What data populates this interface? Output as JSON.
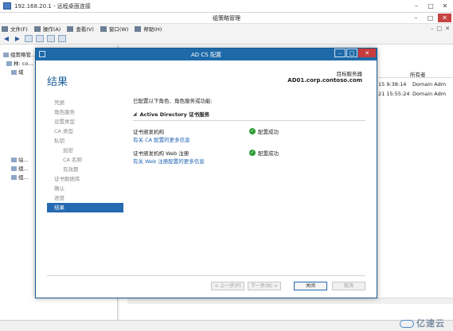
{
  "rdp": {
    "title": "192.168.20.1 - 远程桌面连接",
    "controls": [
      "–",
      "□",
      "✕"
    ]
  },
  "gpm": {
    "title": "组策略管理",
    "menu": [
      {
        "label": "文件(F)",
        "icon": "file-icon"
      },
      {
        "label": "操作(A)",
        "icon": "action-icon"
      },
      {
        "label": "查看(V)",
        "icon": "view-icon"
      },
      {
        "label": "窗口(W)",
        "icon": "window-icon"
      },
      {
        "label": "帮助(H)",
        "icon": "help-icon"
      }
    ],
    "tree": [
      {
        "label": "组策略管..."
      },
      {
        "label": "林: co..."
      },
      {
        "label": "域"
      },
      {
        "label": "站..."
      },
      {
        "label": "组..."
      },
      {
        "label": "组..."
      }
    ],
    "right_header": "所有者",
    "rows": [
      {
        "time": "15 9:38:14",
        "owner": "Domain Adm"
      },
      {
        "time": "21 15:55:24",
        "owner": "Domain Adm"
      }
    ]
  },
  "dialog": {
    "title": "AD CS 配置",
    "heading": "结果",
    "target_label": "目标服务器",
    "target_value": "AD01.corp.contoso.com",
    "nav": [
      {
        "label": "凭据",
        "level": 0,
        "active": false
      },
      {
        "label": "角色服务",
        "level": 0,
        "active": false
      },
      {
        "label": "设置类型",
        "level": 0,
        "active": false
      },
      {
        "label": "CA 类型",
        "level": 0,
        "active": false
      },
      {
        "label": "私钥",
        "level": 0,
        "active": false
      },
      {
        "label": "加密",
        "level": 1,
        "active": false
      },
      {
        "label": "CA 名称",
        "level": 1,
        "active": false
      },
      {
        "label": "有效期",
        "level": 1,
        "active": false
      },
      {
        "label": "证书数据库",
        "level": 0,
        "active": false
      },
      {
        "label": "确认",
        "level": 0,
        "active": false
      },
      {
        "label": "进度",
        "level": 0,
        "active": false
      },
      {
        "label": "结果",
        "level": 0,
        "active": true
      }
    ],
    "summary": "已配置以下角色、角色服务或功能:",
    "section_title": "Active Directory 证书服务",
    "results": [
      {
        "role": "证书颁发机构",
        "link": "有关 CA 配置的更多信息",
        "status": "配置成功"
      },
      {
        "role": "证书颁发机构 Web 注册",
        "link": "有关 Web 注册配置的更多信息",
        "status": "配置成功"
      }
    ],
    "buttons": {
      "prev": "< 上一步(P)",
      "next": "下一步(N) >",
      "close": "关闭",
      "cancel": "取消"
    }
  },
  "watermark": "亿速云"
}
